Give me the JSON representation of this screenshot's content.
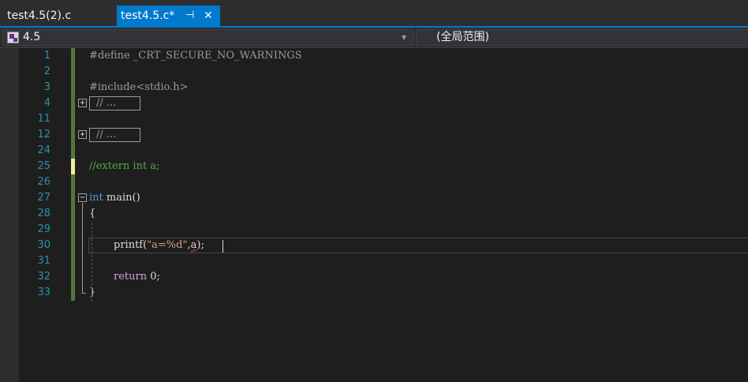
{
  "tabs": {
    "inactive_label": "test4.5(2).c",
    "active_label": "test4.5.c*",
    "pin_glyph": "⊣",
    "close_glyph": "✕"
  },
  "navbar": {
    "project_label": "4.5",
    "scope_label": "(全局范围)"
  },
  "editor": {
    "collapsed_text": "// ...",
    "lines": [
      {
        "num": "1",
        "text": "#define _CRT_SECURE_NO_WARNINGS"
      },
      {
        "num": "2",
        "text": ""
      },
      {
        "num": "3",
        "text": "#include<stdio.h>"
      },
      {
        "num": "4",
        "text": "// ...",
        "collapsed": true
      },
      {
        "num": "11",
        "text": ""
      },
      {
        "num": "12",
        "text": "// ...",
        "collapsed": true
      },
      {
        "num": "24",
        "text": ""
      },
      {
        "num": "25",
        "text": "//extern int a;"
      },
      {
        "num": "26",
        "text": ""
      },
      {
        "num": "27",
        "text": "int main()"
      },
      {
        "num": "28",
        "text": "{"
      },
      {
        "num": "29",
        "text": ""
      },
      {
        "num": "30",
        "text": "printf(\"a=%d\",a);"
      },
      {
        "num": "31",
        "text": ""
      },
      {
        "num": "32",
        "text": "return 0;"
      },
      {
        "num": "33",
        "text": "}"
      }
    ]
  },
  "colors": {
    "tab_active": "#007acc",
    "keyword": "#569cd6",
    "comment": "#57a64a",
    "string": "#d69d85",
    "line_number": "#2b91af",
    "change_saved": "#57743a",
    "change_unsaved": "#efef91"
  }
}
